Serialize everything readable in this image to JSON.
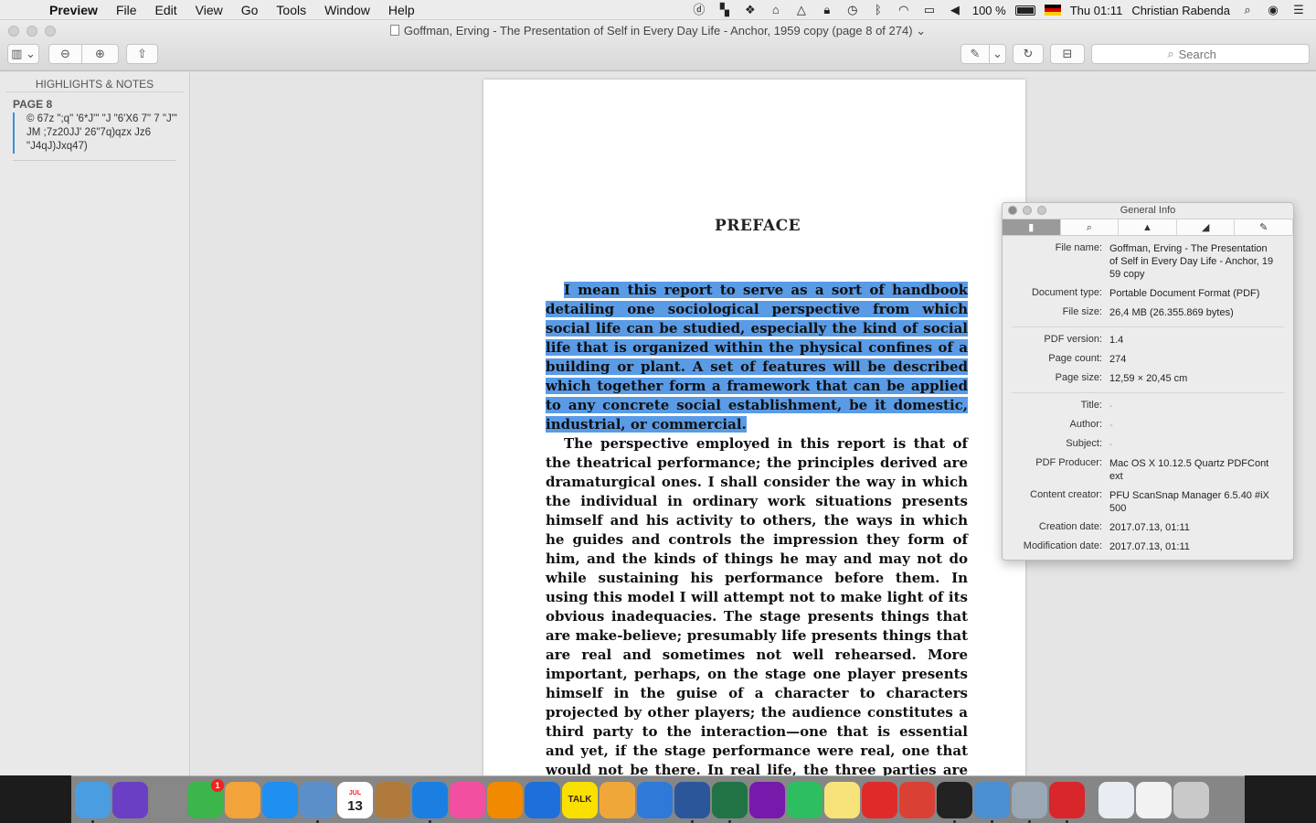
{
  "menubar": {
    "app_name": "Preview",
    "menus": [
      "File",
      "Edit",
      "View",
      "Go",
      "Tools",
      "Window",
      "Help"
    ],
    "battery": "100 %",
    "clock": "Thu 01:11",
    "user": "Christian Rabenda"
  },
  "window": {
    "title": "Goffman, Erving - The Presentation of Self in Every Day Life - Anchor, 1959 copy (page 8 of 274)",
    "search_placeholder": "Search"
  },
  "sidebar": {
    "header": "HIGHLIGHTS & NOTES",
    "page_label": "PAGE 8",
    "note_text": "© 67z \";q\" '6*J'\" \"J \"6'X6 7\" 7 \"J\"' JM ;7z20JJ' 26\"7q)qzx Jz6 \"J4qJ)Jxq47)"
  },
  "document": {
    "heading": "PREFACE",
    "highlighted_text": "I mean this report to serve as a sort of handbook detailing one sociological perspective from which social life can be studied, especially the kind of social life that is organized within the physical confines of a building or plant. A set of features will be described which together form a framework that can be applied to any concrete social establishment, be it domestic, industrial, or commercial.",
    "body_text": "The perspective employed in this report is that of the theatrical performance; the principles derived are dramaturgical ones. I shall consider the way in which the individual in ordinary work situations presents himself and his activity to others, the ways in which he guides and controls the impression they form of him, and the kinds of things he may and may not do while sustaining his performance before them. In using this model I will attempt not to make light of its obvious inadequacies. The stage presents things that are make-believe; presumably life presents things that are real and sometimes not well rehearsed. More important, perhaps, on the stage one player presents himself in the guise of a character to characters projected by other players; the audience constitutes a third party to the interaction—one that is essential and yet, if the stage performance were real, one that would not be there. In real life, the three parties are compressed into two; the part one individual plays is tailored to the parts played by the others present, and yet these others also constitute the audience."
  },
  "info_panel": {
    "title": "General Info",
    "tabs": [
      "document-icon",
      "search-icon",
      "lock-icon",
      "ruler-icon",
      "pencil-icon"
    ],
    "file_name_label": "File name:",
    "file_name": "Goffman, Erving - The Presentation of Self in Every Day Life - Anchor, 1959 copy",
    "document_type_label": "Document type:",
    "document_type": "Portable Document Format (PDF)",
    "file_size_label": "File size:",
    "file_size": "26,4 MB (26.355.869 bytes)",
    "pdf_version_label": "PDF version:",
    "pdf_version": "1.4",
    "page_count_label": "Page count:",
    "page_count": "274",
    "page_size_label": "Page size:",
    "page_size": "12,59 × 20,45 cm",
    "title_label": "Title:",
    "title_value": "-",
    "author_label": "Author:",
    "author_value": "-",
    "subject_label": "Subject:",
    "subject_value": "-",
    "pdf_producer_label": "PDF Producer:",
    "pdf_producer": "Mac OS X 10.12.5 Quartz PDFContext",
    "content_creator_label": "Content creator:",
    "content_creator": "PFU ScanSnap Manager 6.5.40 #iX500",
    "creation_date_label": "Creation date:",
    "creation_date": "2017.07.13, 01:11",
    "modification_date_label": "Modification date:",
    "modification_date": "2017.07.13, 01:11"
  },
  "dock": {
    "calendar_month": "JUL",
    "calendar_day": "13",
    "facetime_badge": "1",
    "kakaotalk_label": "TALK",
    "apps": [
      {
        "name": "finder",
        "color": "#4a9de0"
      },
      {
        "name": "siri",
        "color": "#6a3fc4"
      },
      {
        "name": "system-preferences",
        "color": "#888888"
      },
      {
        "name": "facetime",
        "color": "#3cb54a"
      },
      {
        "name": "photos",
        "color": "#f2a33a"
      },
      {
        "name": "app-store",
        "color": "#1f8ef1"
      },
      {
        "name": "preview",
        "color": "#5b8fc9"
      },
      {
        "name": "calendar",
        "color": "#ffffff"
      },
      {
        "name": "contacts",
        "color": "#b07a3c"
      },
      {
        "name": "safari",
        "color": "#1a7fe0"
      },
      {
        "name": "itunes",
        "color": "#f24fa0"
      },
      {
        "name": "vlc",
        "color": "#f08a00"
      },
      {
        "name": "sync",
        "color": "#1e6fd9"
      },
      {
        "name": "kakaotalk",
        "color": "#f9e000"
      },
      {
        "name": "pages",
        "color": "#f0a73a"
      },
      {
        "name": "keynote",
        "color": "#2f79d8"
      },
      {
        "name": "word",
        "color": "#2b579a"
      },
      {
        "name": "excel",
        "color": "#217346"
      },
      {
        "name": "onenote",
        "color": "#7719aa"
      },
      {
        "name": "evernote",
        "color": "#2dbe60"
      },
      {
        "name": "notes",
        "color": "#f7e37a"
      },
      {
        "name": "bookmarks",
        "color": "#e02a2a"
      },
      {
        "name": "todoist",
        "color": "#db4035"
      },
      {
        "name": "activity-monitor",
        "color": "#222222"
      },
      {
        "name": "screen-sharing",
        "color": "#4a8fd1"
      },
      {
        "name": "image-capture",
        "color": "#9aa7b5"
      },
      {
        "name": "acrobat",
        "color": "#d8262b"
      },
      {
        "name": "documents",
        "color": "#e8edf3"
      },
      {
        "name": "text-file",
        "color": "#f2f2f2"
      },
      {
        "name": "trash",
        "color": "#c9c9c9"
      }
    ]
  }
}
